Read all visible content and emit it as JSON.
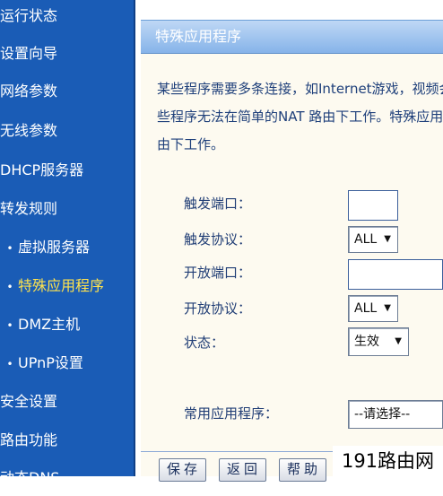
{
  "sidebar": {
    "items": [
      {
        "label": "运行状态",
        "sub": false,
        "active": false
      },
      {
        "label": "设置向导",
        "sub": false,
        "active": false
      },
      {
        "label": "网络参数",
        "sub": false,
        "active": false
      },
      {
        "label": "无线参数",
        "sub": false,
        "active": false
      },
      {
        "label": "DHCP服务器",
        "sub": false,
        "active": false
      },
      {
        "label": "转发规则",
        "sub": false,
        "active": false
      },
      {
        "label": "虚拟服务器",
        "sub": true,
        "active": false
      },
      {
        "label": "特殊应用程序",
        "sub": true,
        "active": true
      },
      {
        "label": "DMZ主机",
        "sub": true,
        "active": false
      },
      {
        "label": "UPnP设置",
        "sub": true,
        "active": false
      },
      {
        "label": "安全设置",
        "sub": false,
        "active": false
      },
      {
        "label": "路由功能",
        "sub": false,
        "active": false
      },
      {
        "label": "动态DNS",
        "sub": false,
        "active": false
      }
    ],
    "bullet": "•",
    "bg_color": "#1a5cb6",
    "active_color": "#ffe34d"
  },
  "main": {
    "title": "特殊应用程序",
    "description": [
      "某些程序需要多条连接，如Internet游戏，视频会",
      "些程序无法在简单的NAT 路由下工作。特殊应用程",
      "由下工作。"
    ]
  },
  "form": {
    "trigger_port": {
      "label": "触发端口：",
      "value": ""
    },
    "trigger_protocol": {
      "label": "触发协议：",
      "value": "ALL"
    },
    "open_port": {
      "label": "开放端口：",
      "value": ""
    },
    "open_protocol": {
      "label": "开放协议：",
      "value": "ALL"
    },
    "status": {
      "label": "状态：",
      "value": "生效"
    },
    "common_apps": {
      "label": "常用应用程序：",
      "value": "--请选择--"
    }
  },
  "buttons": {
    "save": "保存",
    "back": "返回",
    "help": "帮助"
  },
  "watermark": "191路由网",
  "icons": {
    "dropdown": "chevron-down-icon"
  }
}
